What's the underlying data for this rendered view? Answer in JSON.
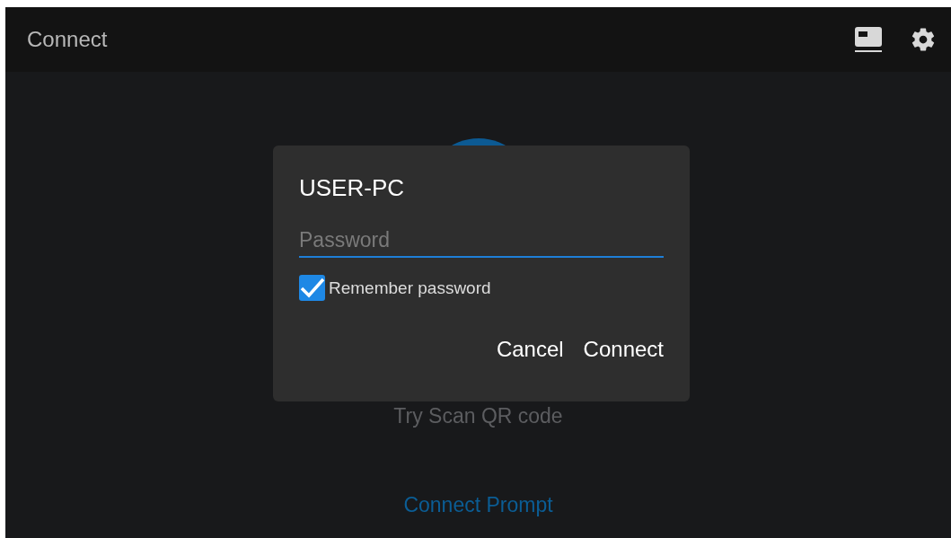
{
  "app_bar": {
    "title": "Connect"
  },
  "background": {
    "hint": "Try Scan QR code",
    "link": "Connect Prompt"
  },
  "dialog": {
    "title": "USER-PC",
    "password": {
      "placeholder": "Password"
    },
    "remember": {
      "label": "Remember password",
      "checked": true
    },
    "buttons": [
      "Cancel",
      "Connect"
    ]
  }
}
